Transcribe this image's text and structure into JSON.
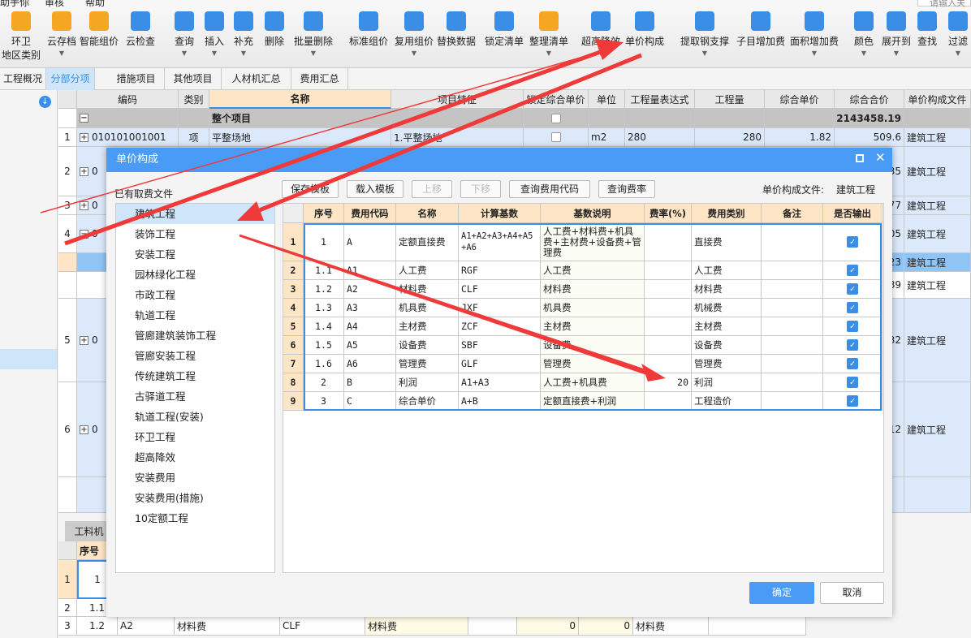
{
  "menu": [
    "助手你",
    "审核",
    "帮助"
  ],
  "search_placeholder": "请输入关",
  "toolbar": [
    {
      "label": "环卫",
      "label2": "地区类别",
      "icon": "region-category-icon",
      "dd": false,
      "color": "#f5a623"
    },
    {
      "label": "云存档",
      "icon": "cloud-save-icon",
      "dd": true,
      "color": "#f5a623"
    },
    {
      "label": "智能组价",
      "icon": "smart-pricing-icon",
      "dd": false,
      "color": "#f5a623"
    },
    {
      "label": "云检查",
      "icon": "cloud-check-icon",
      "dd": false,
      "color": "#3a8ee6"
    },
    {
      "label": "查询",
      "icon": "query-icon",
      "dd": true,
      "color": "#3a8ee6"
    },
    {
      "label": "插入",
      "icon": "insert-icon",
      "dd": true,
      "color": "#3a8ee6"
    },
    {
      "label": "补充",
      "icon": "supplement-icon",
      "dd": true,
      "color": "#3a8ee6"
    },
    {
      "label": "删除",
      "icon": "delete-icon",
      "dd": false,
      "color": "#3a8ee6"
    },
    {
      "label": "批量删除",
      "icon": "batch-delete-icon",
      "dd": true,
      "color": "#3a8ee6"
    },
    {
      "label": "标准组价",
      "icon": "standard-pricing-icon",
      "dd": false,
      "color": "#3a8ee6"
    },
    {
      "label": "复用组价",
      "icon": "reuse-pricing-icon",
      "dd": true,
      "color": "#3a8ee6"
    },
    {
      "label": "替换数据",
      "icon": "replace-data-icon",
      "dd": false,
      "color": "#3a8ee6"
    },
    {
      "label": "锁定清单",
      "icon": "lock-icon",
      "dd": false,
      "color": "#3a8ee6"
    },
    {
      "label": "整理清单",
      "icon": "organize-list-icon",
      "dd": true,
      "color": "#f5a623"
    },
    {
      "label": "超高降效",
      "icon": "height-reduction-icon",
      "dd": true,
      "color": "#3a8ee6"
    },
    {
      "label": "单价构成",
      "icon": "unit-price-icon",
      "dd": false,
      "color": "#3a8ee6"
    },
    {
      "label": "提取钢支撑",
      "icon": "steel-support-icon",
      "dd": true,
      "color": "#3a8ee6"
    },
    {
      "label": "子目增加费",
      "icon": "item-fee-icon",
      "dd": false,
      "color": "#3a8ee6"
    },
    {
      "label": "面积增加费",
      "icon": "area-fee-icon",
      "dd": true,
      "color": "#3a8ee6"
    },
    {
      "label": "颜色",
      "icon": "color-icon",
      "dd": true,
      "color": "#3a8ee6"
    },
    {
      "label": "展开到",
      "icon": "expand-icon",
      "dd": true,
      "color": "#3a8ee6"
    },
    {
      "label": "查找",
      "icon": "find-icon",
      "dd": false,
      "color": "#3a8ee6"
    },
    {
      "label": "过滤",
      "icon": "filter-icon",
      "dd": true,
      "color": "#3a8ee6"
    }
  ],
  "tabs": [
    "工程概况",
    "分部分项",
    "措施项目",
    "其他项目",
    "人材机汇总",
    "费用汇总"
  ],
  "grid": {
    "headers": [
      "编码",
      "类别",
      "名称",
      "项目特征",
      "锁定综合单价",
      "单位",
      "工程量表达式",
      "工程量",
      "综合单价",
      "综合合价",
      "单价构成文件"
    ],
    "total_row": {
      "name": "整个项目",
      "total": "2143458.19"
    },
    "row1": {
      "num": "1",
      "code": "010101001001",
      "type": "项",
      "name": "平整场地",
      "feature": "1.平整场地",
      "unit": "m2",
      "expr": "280",
      "qty": "280",
      "price": "1.82",
      "total": "509.6",
      "file": "建筑工程"
    },
    "rows": [
      {
        "num": "2",
        "code": "0",
        "total": "35",
        "file": "建筑工程"
      },
      {
        "num": "3",
        "code": "0",
        "total": "77",
        "file": "建筑工程"
      },
      {
        "num": "4",
        "code": "0",
        "total": "05",
        "file": "建筑工程"
      },
      {
        "num": "",
        "code": "",
        "total": "23",
        "file": "建筑工程"
      },
      {
        "num": "",
        "code": "",
        "total": "89",
        "file": "建筑工程"
      },
      {
        "num": "5",
        "code": "0",
        "total": "32",
        "file": "建筑工程"
      },
      {
        "num": "6",
        "code": "0",
        "total": "12",
        "file": "建筑工程"
      }
    ]
  },
  "bottom": {
    "tab": "工料机",
    "header": "序号",
    "rows": [
      {
        "rn": "1",
        "seq": "1"
      },
      {
        "rn": "2",
        "seq": "1.1"
      },
      {
        "rn": "3",
        "seq": "1.2",
        "code": "A2",
        "name": "材料费",
        "base": "CLF",
        "desc": "材料费",
        "v1": "0",
        "v2": "0",
        "type": "材料费"
      }
    ]
  },
  "dialog": {
    "title": "单价构成",
    "list_label": "已有取费文件",
    "buttons": {
      "save": "保存模板",
      "load": "载入模板",
      "up": "上移",
      "down": "下移",
      "query_code": "查询费用代码",
      "query_rate": "查询费率"
    },
    "file_label": "单价构成文件:",
    "file_value": "建筑工程",
    "files": [
      "建筑工程",
      "装饰工程",
      "安装工程",
      "园林绿化工程",
      "市政工程",
      "轨道工程",
      "管廊建筑装饰工程",
      "管廊安装工程",
      "传统建筑工程",
      "古驿道工程",
      "轨道工程(安装)",
      "环卫工程",
      "超高降效",
      "安装费用",
      "安装费用(措施)",
      "10定额工程"
    ],
    "table_headers": [
      "序号",
      "费用代码",
      "名称",
      "计算基数",
      "基数说明",
      "费率(%)",
      "费用类别",
      "备注",
      "是否输出"
    ],
    "rows": [
      {
        "seq": "1",
        "code": "A",
        "name": "定额直接费",
        "base": "A1+A2+A3+A4+A5+A6",
        "desc": "人工费+材料费+机具费+主材费+设备费+管理费",
        "rate": "",
        "type": "直接费",
        "note": "",
        "out": true
      },
      {
        "seq": "1.1",
        "code": "A1",
        "name": "人工费",
        "base": "RGF",
        "desc": "人工费",
        "rate": "",
        "type": "人工费",
        "note": "",
        "out": true
      },
      {
        "seq": "1.2",
        "code": "A2",
        "name": "材料费",
        "base": "CLF",
        "desc": "材料费",
        "rate": "",
        "type": "材料费",
        "note": "",
        "out": true
      },
      {
        "seq": "1.3",
        "code": "A3",
        "name": "机具费",
        "base": "JXF",
        "desc": "机具费",
        "rate": "",
        "type": "机械费",
        "note": "",
        "out": true
      },
      {
        "seq": "1.4",
        "code": "A4",
        "name": "主材费",
        "base": "ZCF",
        "desc": "主材费",
        "rate": "",
        "type": "主材费",
        "note": "",
        "out": true
      },
      {
        "seq": "1.5",
        "code": "A5",
        "name": "设备费",
        "base": "SBF",
        "desc": "设备费",
        "rate": "",
        "type": "设备费",
        "note": "",
        "out": true
      },
      {
        "seq": "1.6",
        "code": "A6",
        "name": "管理费",
        "base": "GLF",
        "desc": "管理费",
        "rate": "",
        "type": "管理费",
        "note": "",
        "out": true
      },
      {
        "seq": "2",
        "code": "B",
        "name": "利润",
        "base": "A1+A3",
        "desc": "人工费+机具费",
        "rate": "20",
        "type": "利润",
        "note": "",
        "out": true
      },
      {
        "seq": "3",
        "code": "C",
        "name": "综合单价",
        "base": "A+B",
        "desc": "定额直接费+利润",
        "rate": "",
        "type": "工程造价",
        "note": "",
        "out": true
      }
    ],
    "ok": "确定",
    "cancel": "取消"
  },
  "colors": {
    "accent": "#4a9bf5",
    "header": "#fde5c5",
    "annotation": "#f03a3a"
  }
}
